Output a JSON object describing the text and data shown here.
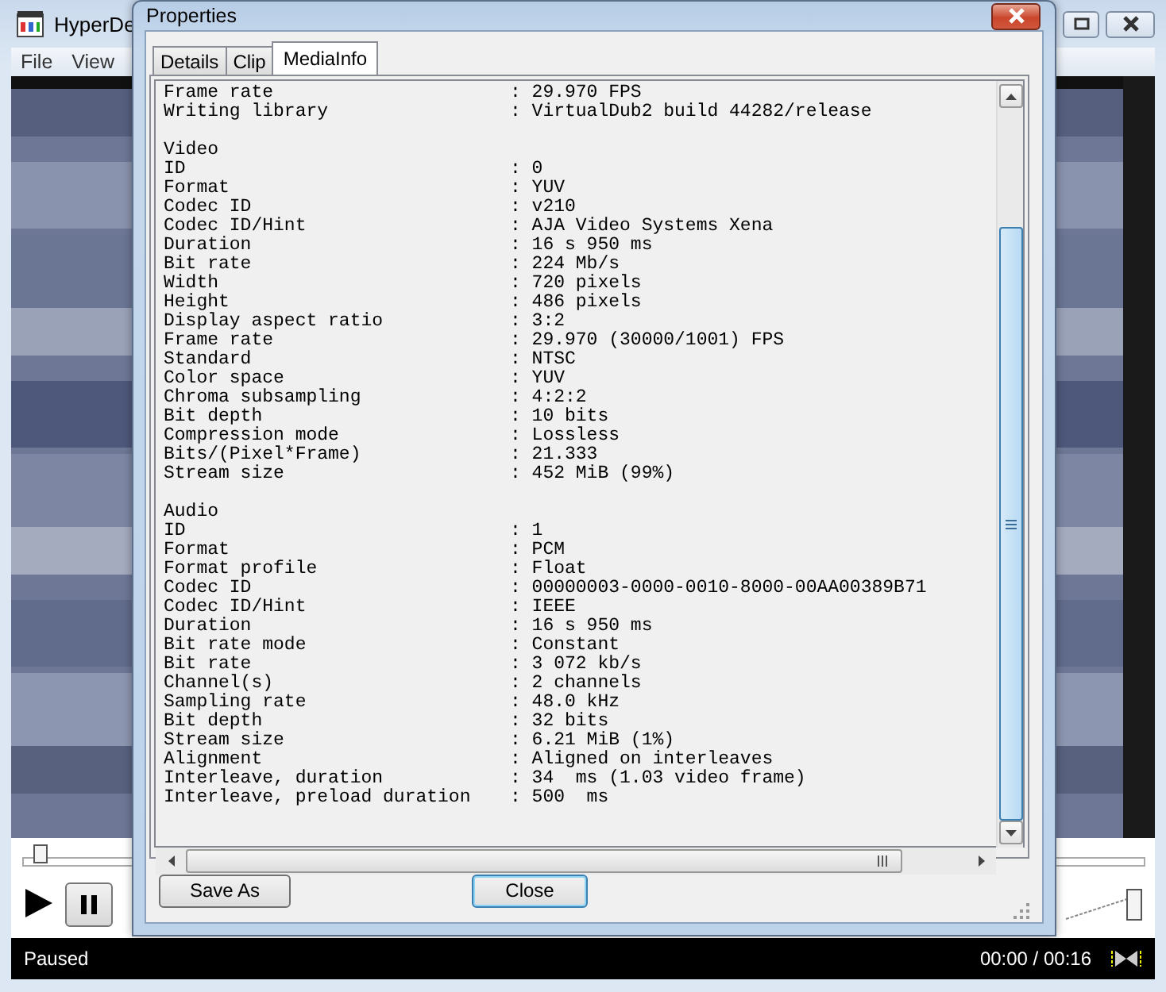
{
  "app_window": {
    "title": "HyperDe",
    "menu": [
      "File",
      "View"
    ],
    "seek": {
      "level": 0.01
    },
    "volume": {
      "level": 1
    },
    "status": "Paused",
    "time": "00:00 / 00:16"
  },
  "dialog": {
    "title": "Properties",
    "tabs": [
      {
        "label": "Details",
        "selected": false
      },
      {
        "label": "Clip",
        "selected": false
      },
      {
        "label": "MediaInfo",
        "selected": true
      }
    ],
    "media_info": [
      {
        "rows": [
          {
            "label": "Frame rate",
            "value": ": 29.970 FPS"
          },
          {
            "label": "Writing library",
            "value": ": VirtualDub2 build 44282/release"
          }
        ]
      },
      {
        "heading": "Video",
        "rows": [
          {
            "label": "ID",
            "value": ": 0"
          },
          {
            "label": "Format",
            "value": ": YUV"
          },
          {
            "label": "Codec ID",
            "value": ": v210"
          },
          {
            "label": "Codec ID/Hint",
            "value": ": AJA Video Systems Xena"
          },
          {
            "label": "Duration",
            "value": ": 16 s 950 ms"
          },
          {
            "label": "Bit rate",
            "value": ": 224 Mb/s"
          },
          {
            "label": "Width",
            "value": ": 720 pixels"
          },
          {
            "label": "Height",
            "value": ": 486 pixels"
          },
          {
            "label": "Display aspect ratio",
            "value": ": 3:2"
          },
          {
            "label": "Frame rate",
            "value": ": 29.970 (30000/1001) FPS"
          },
          {
            "label": "Standard",
            "value": ": NTSC"
          },
          {
            "label": "Color space",
            "value": ": YUV"
          },
          {
            "label": "Chroma subsampling",
            "value": ": 4:2:2"
          },
          {
            "label": "Bit depth",
            "value": ": 10 bits"
          },
          {
            "label": "Compression mode",
            "value": ": Lossless"
          },
          {
            "label": "Bits/(Pixel*Frame)",
            "value": ": 21.333"
          },
          {
            "label": "Stream size",
            "value": ": 452 MiB (99%)"
          }
        ]
      },
      {
        "heading": "Audio",
        "rows": [
          {
            "label": "ID",
            "value": ": 1"
          },
          {
            "label": "Format",
            "value": ": PCM"
          },
          {
            "label": "Format profile",
            "value": ": Float"
          },
          {
            "label": "Codec ID",
            "value": ": 00000003-0000-0010-8000-00AA00389B71"
          },
          {
            "label": "Codec ID/Hint",
            "value": ": IEEE"
          },
          {
            "label": "Duration",
            "value": ": 16 s 950 ms"
          },
          {
            "label": "Bit rate mode",
            "value": ": Constant"
          },
          {
            "label": "Bit rate",
            "value": ": 3 072 kb/s"
          },
          {
            "label": "Channel(s)",
            "value": ": 2 channels"
          },
          {
            "label": "Sampling rate",
            "value": ": 48.0 kHz"
          },
          {
            "label": "Bit depth",
            "value": ": 32 bits"
          },
          {
            "label": "Stream size",
            "value": ": 6.21 MiB (1%)"
          },
          {
            "label": "Alignment",
            "value": ": Aligned on interleaves"
          },
          {
            "label": "Interleave, duration",
            "value": ": 34  ms (1.03 video frame)"
          },
          {
            "label": "Interleave, preload duration",
            "value": ": 500  ms"
          }
        ]
      }
    ],
    "buttons": [
      {
        "label": "Save As",
        "default": false
      },
      {
        "label": "Close",
        "default": true
      }
    ]
  }
}
